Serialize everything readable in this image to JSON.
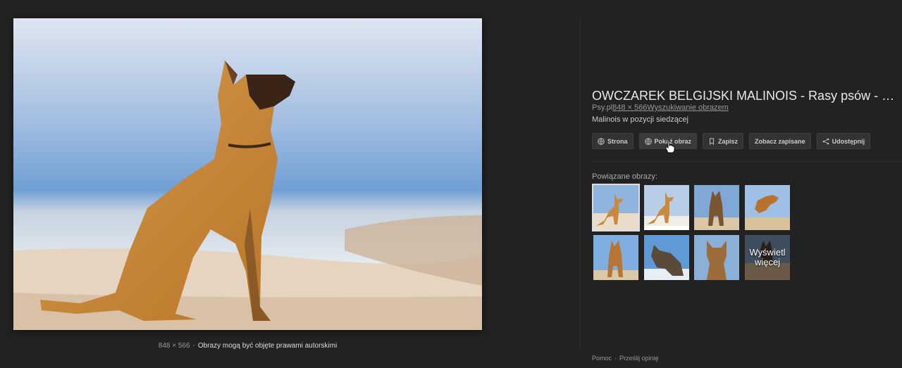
{
  "image": {
    "dimensions": "848 × 566",
    "copyright_note": "Obrazy mogą być objęte prawami autorskimi"
  },
  "panel": {
    "title": "OWCZAREK BELGIJSKI MALINOIS - Rasy psów - PSY.PL",
    "source": "Psy.pl",
    "size": "848 × 566",
    "search_by_image": "Wyszukiwanie obrazem",
    "description": "Malinois w pozycji siedzącej",
    "actions": {
      "visit": "Strona",
      "view_image": "Pokaż obraz",
      "save": "Zapisz",
      "view_saved": "Zobacz zapisane",
      "share": "Udostępnij"
    },
    "related_label": "Powiązane obrazy:",
    "more_label": "Wyświetl więcej",
    "related": [
      {
        "icon": "dog-thumbnail-icon",
        "selected": true
      },
      {
        "icon": "dog-thumbnail-icon",
        "selected": false
      },
      {
        "icon": "dog-thumbnail-icon",
        "selected": false
      },
      {
        "icon": "dog-thumbnail-icon",
        "selected": false
      },
      {
        "icon": "dog-thumbnail-icon",
        "selected": false
      },
      {
        "icon": "dog-thumbnail-icon",
        "selected": false
      },
      {
        "icon": "dog-thumbnail-icon",
        "selected": false
      }
    ]
  },
  "footer": {
    "help": "Pomoc",
    "feedback": "Prześlij opinię"
  },
  "colors": {
    "background": "#222222",
    "button": "#333333",
    "text": "#cccccc"
  }
}
